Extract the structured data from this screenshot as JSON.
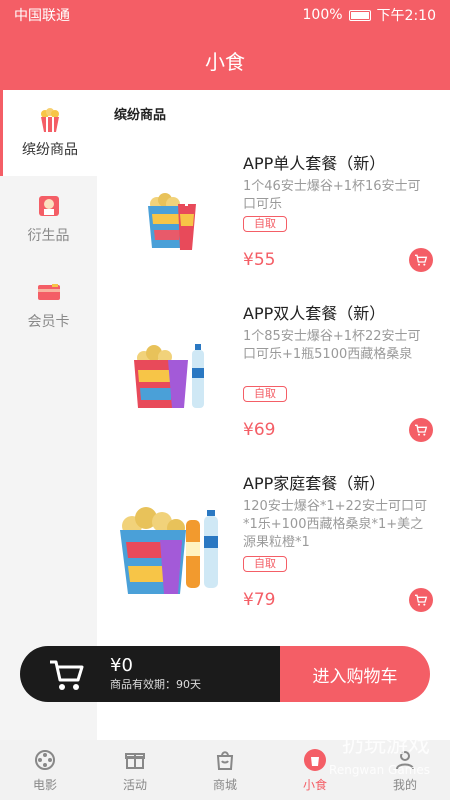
{
  "status": {
    "carrier": "中国联通",
    "battery": "100%",
    "time": "下午2:10"
  },
  "header": {
    "title": "小食"
  },
  "sidebar": {
    "items": [
      {
        "label": "缤纷商品",
        "icon": "popcorn-icon",
        "active": true
      },
      {
        "label": "衍生品",
        "icon": "merch-icon",
        "active": false
      },
      {
        "label": "会员卡",
        "icon": "member-card-icon",
        "active": false
      }
    ]
  },
  "section": {
    "title": "缤纷商品"
  },
  "products": [
    {
      "name": "APP单人套餐（新）",
      "desc": "1个46安士爆谷+1杯16安士可口可乐",
      "tag": "自取",
      "price": "¥55"
    },
    {
      "name": "APP双人套餐（新）",
      "desc": "1个85安士爆谷+1杯22安士可口可乐+1瓶5100西藏格桑泉",
      "tag": "自取",
      "price": "¥69"
    },
    {
      "name": "APP家庭套餐（新）",
      "desc": "120安士爆谷*1+22安士可口可*1乐+100西藏格桑泉*1+美之源果粒橙*1",
      "tag": "自取",
      "price": "¥79"
    }
  ],
  "cart": {
    "total": "¥0",
    "validity": "商品有效期：90天",
    "checkout": "进入购物车"
  },
  "tabbar": {
    "items": [
      {
        "label": "电影",
        "icon": "film-reel-icon",
        "active": false
      },
      {
        "label": "活动",
        "icon": "gift-box-icon",
        "active": false
      },
      {
        "label": "商城",
        "icon": "shopping-bag-icon",
        "active": false
      },
      {
        "label": "小食",
        "icon": "snack-icon",
        "active": true
      },
      {
        "label": "我的",
        "icon": "profile-icon",
        "active": false
      }
    ]
  },
  "watermark": {
    "main": "扔玩游戏",
    "sub": "Rengwan Games"
  },
  "colors": {
    "accent": "#f45e66",
    "dark": "#1b1b1b"
  }
}
